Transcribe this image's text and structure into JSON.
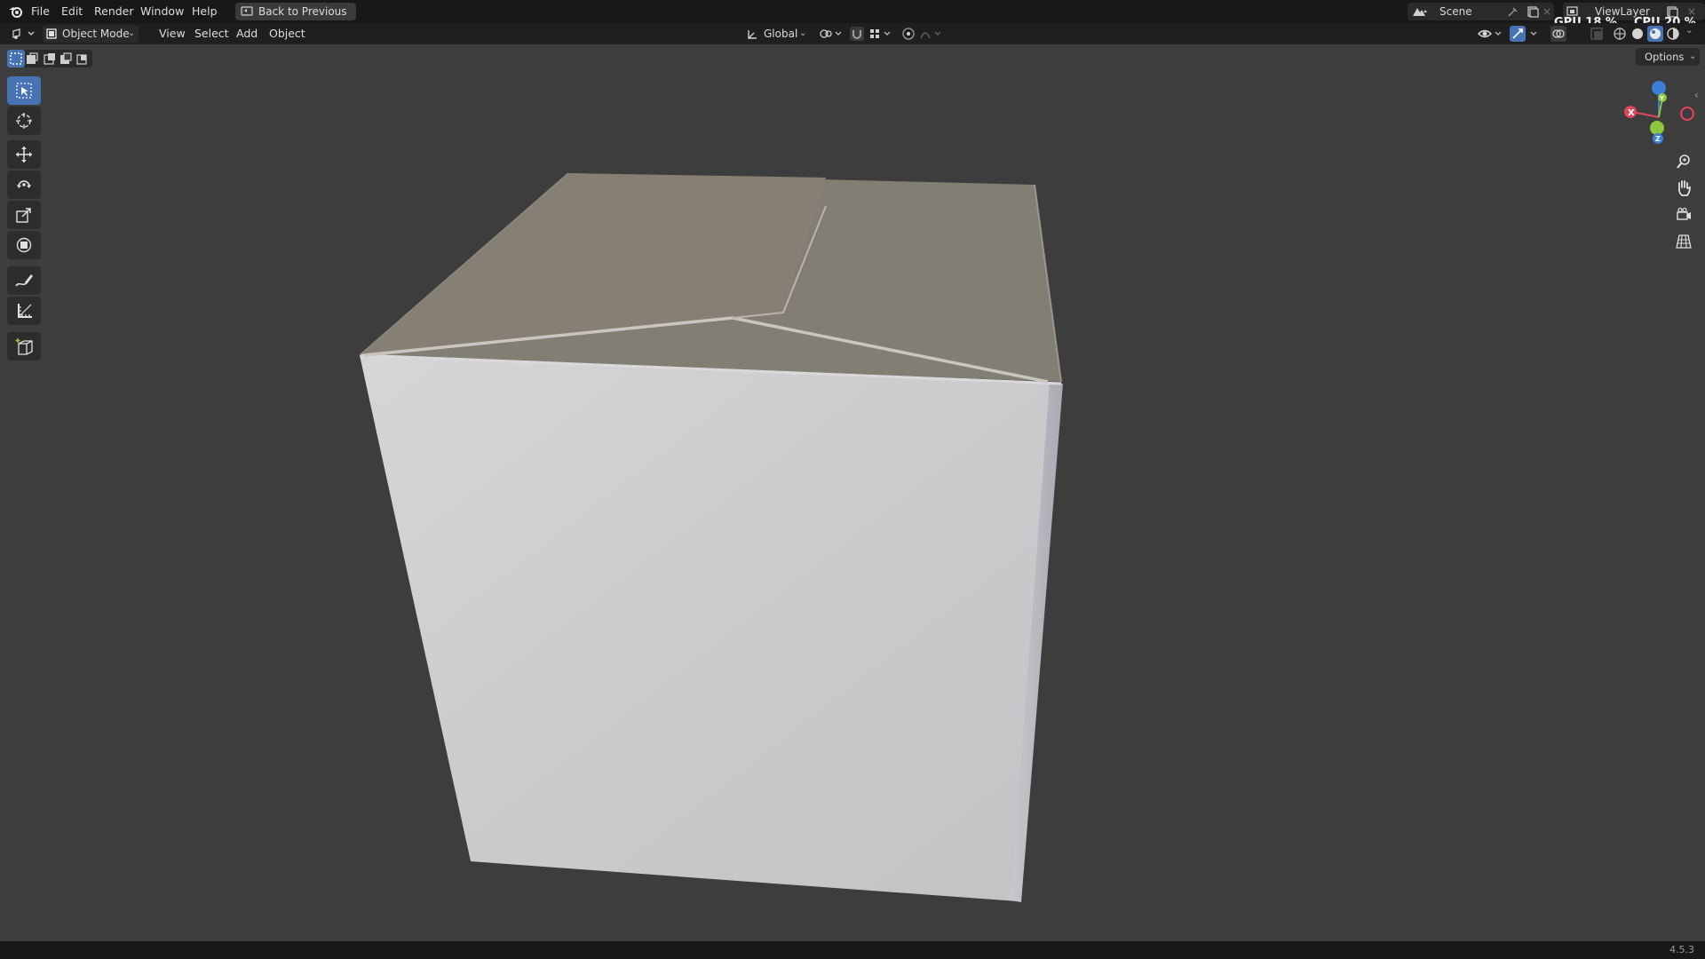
{
  "app": {
    "menus": [
      "File",
      "Edit",
      "Render",
      "Window",
      "Help"
    ],
    "back_button": "Back to Previous",
    "scene_label": "Scene",
    "view_layer_label": "ViewLayer",
    "gpu_label": "GPU",
    "gpu_value": "18 %",
    "cpu_label": "CPU",
    "cpu_value": "20 %"
  },
  "header": {
    "mode": "Object Mode",
    "menus": [
      "View",
      "Select",
      "Add",
      "Object"
    ],
    "orientation": "Global",
    "options": "Options"
  },
  "tools": [
    "select-box",
    "cursor",
    "move",
    "rotate",
    "scale",
    "transform",
    "annotate",
    "measure",
    "add-cube"
  ],
  "gizmo": {
    "x": "X",
    "y": "Y",
    "z": "Z"
  },
  "status": {
    "version": "4.5.3"
  },
  "colors": {
    "accent": "#4772b3",
    "x_axis": "#e0455a",
    "y_axis": "#8ec63f",
    "z_axis": "#3d7fd6"
  }
}
